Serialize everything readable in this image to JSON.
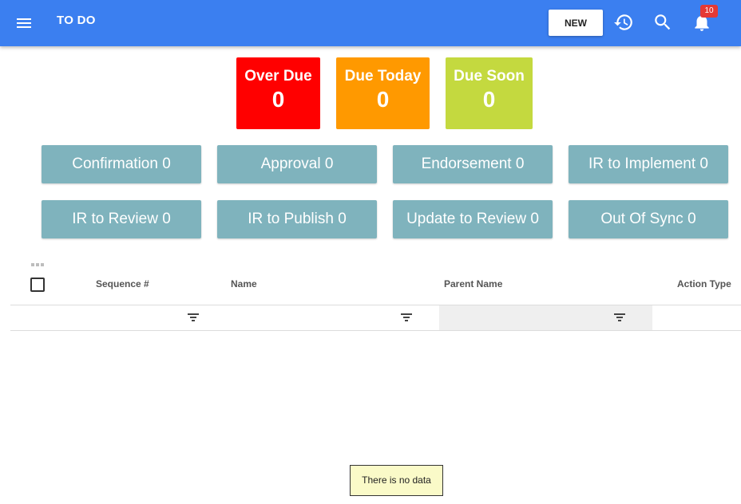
{
  "appbar": {
    "title": "TO DO",
    "new_label": "NEW",
    "notification_count": "10",
    "color": "#3b7ff0",
    "icons": [
      "menu-icon",
      "history-icon",
      "search-icon",
      "bell-icon"
    ]
  },
  "tiles": [
    {
      "label": "Over Due",
      "count": "0",
      "color": "#ff0000"
    },
    {
      "label": "Due Today",
      "count": "0",
      "color": "#ff9900"
    },
    {
      "label": "Due Soon",
      "count": "0",
      "color": "#c4d93f"
    }
  ],
  "categories": [
    "Confirmation 0",
    "Approval 0",
    "Endorsement 0",
    "IR to Implement 0",
    "IR to Review 0",
    "IR to Publish 0",
    "Update to Review 0",
    "Out Of Sync 0"
  ],
  "grid": {
    "columns": [
      "Sequence #",
      "Name",
      "Parent Name",
      "Action Type"
    ],
    "rows": [],
    "empty_message": "There is no data"
  }
}
